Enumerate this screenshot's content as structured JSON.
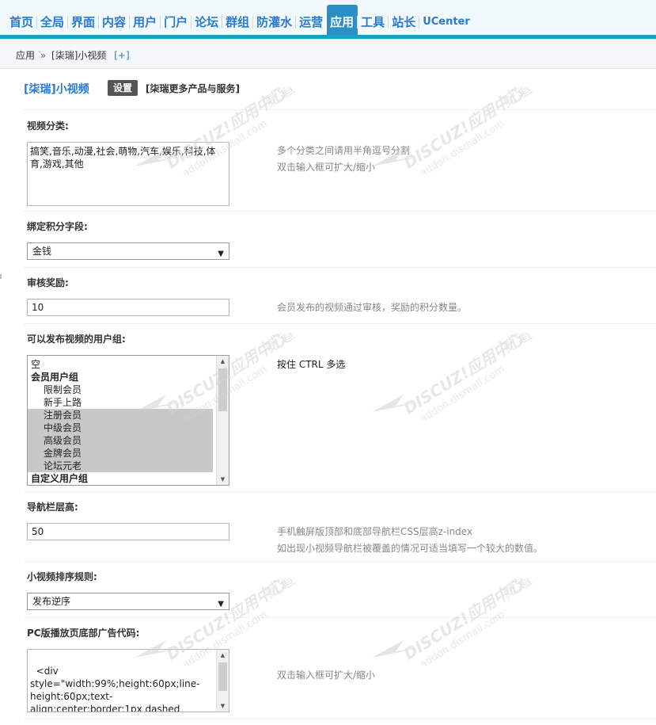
{
  "nav": {
    "items": [
      {
        "label": "首页",
        "active": false
      },
      {
        "label": "全局",
        "active": false
      },
      {
        "label": "界面",
        "active": false
      },
      {
        "label": "内容",
        "active": false
      },
      {
        "label": "用户",
        "active": false
      },
      {
        "label": "门户",
        "active": false
      },
      {
        "label": "论坛",
        "active": false
      },
      {
        "label": "群组",
        "active": false
      },
      {
        "label": "防灌水",
        "active": false
      },
      {
        "label": "运营",
        "active": false
      },
      {
        "label": "应用",
        "active": true
      },
      {
        "label": "工具",
        "active": false
      },
      {
        "label": "站长",
        "active": false
      },
      {
        "label": "UCenter",
        "active": false
      }
    ]
  },
  "breadcrumb": {
    "root": "应用",
    "sep": "»",
    "current": "[柒瑞]小视频",
    "add": "[+]"
  },
  "plugin": {
    "title": "[柒瑞]小视频",
    "setting_tag": "设置",
    "more_link": "[柒瑞更多产品与服务]"
  },
  "fields": {
    "video_category": {
      "label": "视频分类:",
      "value": "搞笑,音乐,动漫,社会,萌物,汽车,娱乐,科技,体育,游戏,其他",
      "hint1": "多个分类之间请用半角逗号分割",
      "hint2": "双击输入框可扩大/缩小"
    },
    "credit_field": {
      "label": "绑定积分字段:",
      "value": "金钱"
    },
    "audit_reward": {
      "label": "审核奖励:",
      "value": "10",
      "hint": "会员发布的视频通过审核，奖励的积分数量。"
    },
    "user_groups": {
      "label": "可以发布视频的用户组:",
      "hint": "按住 CTRL 多选",
      "options": [
        {
          "label": "空",
          "type": "item",
          "selected": false
        },
        {
          "label": "会员用户组",
          "type": "group",
          "selected": false
        },
        {
          "label": "限制会员",
          "type": "indent",
          "selected": false
        },
        {
          "label": "新手上路",
          "type": "indent",
          "selected": false
        },
        {
          "label": "注册会员",
          "type": "indent",
          "selected": true
        },
        {
          "label": "中级会员",
          "type": "indent",
          "selected": true
        },
        {
          "label": "高级会员",
          "type": "indent",
          "selected": true
        },
        {
          "label": "金牌会员",
          "type": "indent",
          "selected": true
        },
        {
          "label": "论坛元老",
          "type": "indent",
          "selected": true
        },
        {
          "label": "自定义用户组",
          "type": "group",
          "selected": false
        }
      ]
    },
    "nav_zindex": {
      "label": "导航栏层高:",
      "value": "50",
      "hint1": "手机触屏版顶部和底部导航栏CSS层高z-index",
      "hint2": "如出现小视频导航栏被覆盖的情况可适当填写一个较大的数值。"
    },
    "sort_rule": {
      "label": "小视频排序规则:",
      "value": "发布逆序"
    },
    "pc_ad": {
      "label": "PC版播放页底部广告代码:",
      "value": "<div\nstyle=\"width:99%;height:60px;line-\nheight:60px;text-\nalign:center;border:1px dashed\n#CFCFCF;\">PC版播放页底部广告，请从",
      "hint": "双击输入框可扩大/缩小"
    }
  },
  "watermark": {
    "brand": "DISCUZ!应用中心",
    "url": "addon.dismall.com",
    "mark": "贰道"
  }
}
